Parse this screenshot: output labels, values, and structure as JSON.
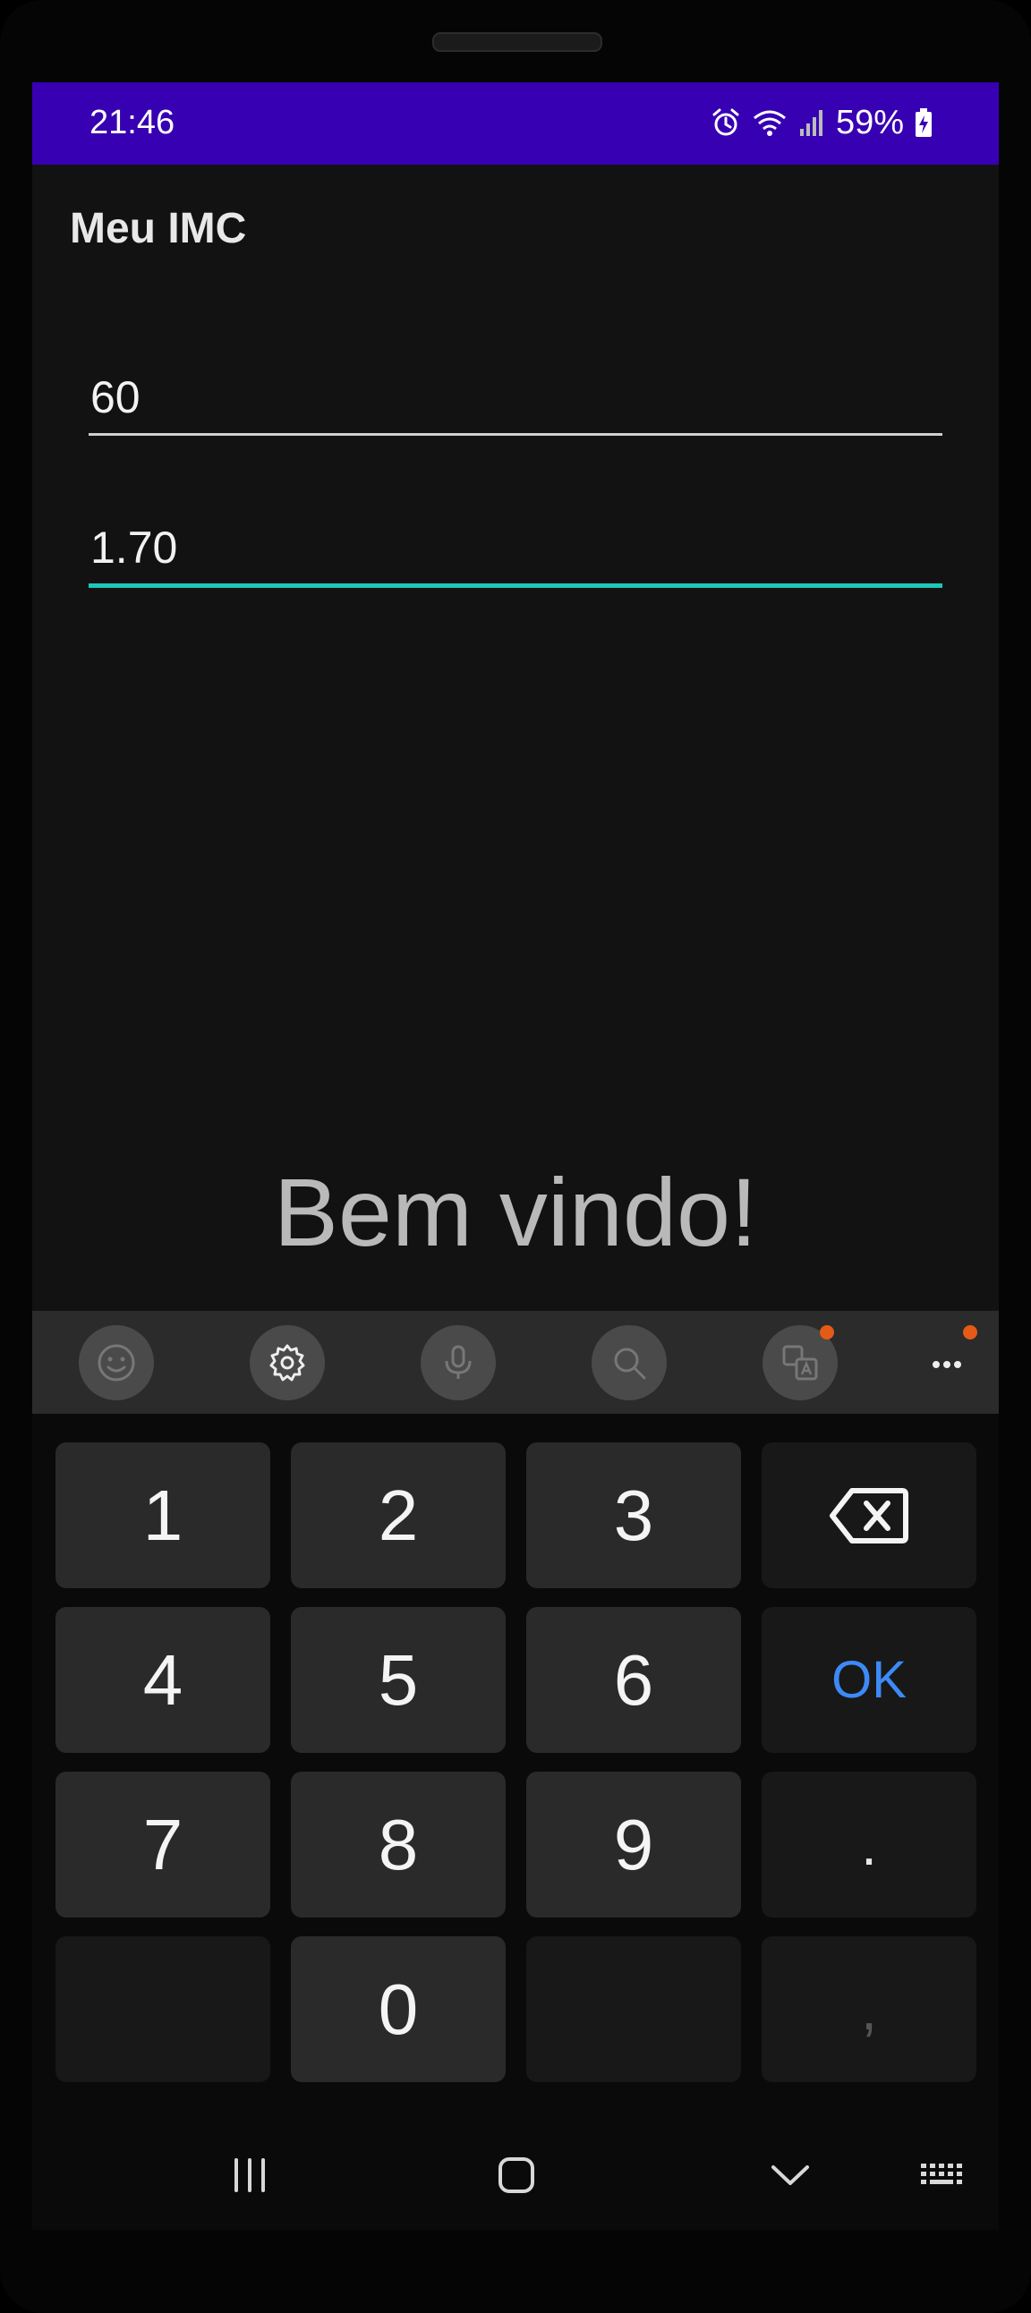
{
  "status_bar": {
    "time": "21:46",
    "battery": "59%",
    "icons": [
      "alarm-icon",
      "wifi-icon",
      "signal-icon",
      "battery-charging-icon"
    ],
    "background_color": "#3700b3"
  },
  "app": {
    "title": "Meu IMC"
  },
  "form": {
    "weight_value": "60",
    "height_value": "1.70",
    "focus_color": "#1ec8b7"
  },
  "welcome_text": "Bem vindo!",
  "keyboard_toolbar": {
    "buttons": [
      "emoji-icon",
      "settings-icon",
      "microphone-icon",
      "search-icon",
      "translate-icon",
      "more-options-icon"
    ]
  },
  "keyboard": {
    "keys": {
      "k1": "1",
      "k2": "2",
      "k3": "3",
      "k4": "4",
      "k5": "5",
      "k6": "6",
      "k7": "7",
      "k8": "8",
      "k9": "9",
      "k0": "0",
      "ok": "OK",
      "dot": ".",
      "comma": ","
    },
    "ok_color": "#3d8af7"
  },
  "nav_bar": {
    "buttons": [
      "recent-apps-icon",
      "home-icon",
      "back-icon",
      "keyboard-switch-icon"
    ]
  }
}
